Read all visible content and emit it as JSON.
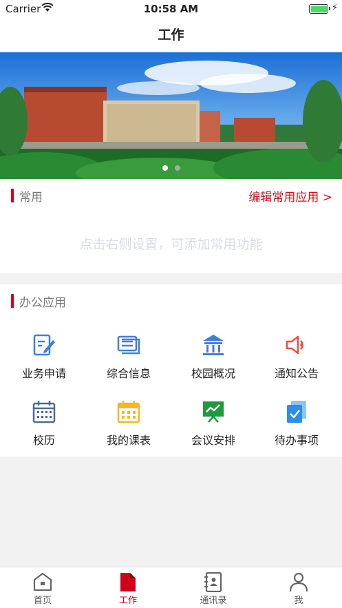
{
  "status": {
    "carrier": "Carrier",
    "time": "10:58 AM"
  },
  "nav": {
    "title": "工作"
  },
  "banner": {
    "slide_count": 2,
    "active_slide": 1
  },
  "common": {
    "title": "常用",
    "edit_link": "编辑常用应用 >",
    "empty_hint": "点击右侧设置，可添加常用功能"
  },
  "office": {
    "title": "办公应用",
    "items": [
      {
        "label": "业务申请",
        "icon": "edit-form-icon",
        "color": "#3f7fd8"
      },
      {
        "label": "综合信息",
        "icon": "info-list-icon",
        "color": "#3f7fd8"
      },
      {
        "label": "校园概况",
        "icon": "campus-building-icon",
        "color": "#3f7fd8"
      },
      {
        "label": "通知公告",
        "icon": "speaker-icon",
        "color": "#e8503c"
      },
      {
        "label": "校历",
        "icon": "calendar-icon",
        "color": "#4a6a9a"
      },
      {
        "label": "我的课表",
        "icon": "schedule-icon",
        "color": "#f5b820"
      },
      {
        "label": "会议安排",
        "icon": "meeting-board-icon",
        "color": "#1e9a3c"
      },
      {
        "label": "待办事项",
        "icon": "todo-icon",
        "color": "#2e8de8"
      }
    ]
  },
  "tabs": [
    {
      "label": "首页",
      "icon": "home-icon"
    },
    {
      "label": "工作",
      "icon": "work-doc-icon"
    },
    {
      "label": "通讯录",
      "icon": "contacts-icon"
    },
    {
      "label": "我",
      "icon": "profile-icon"
    }
  ],
  "colors": {
    "accent": "#d0021b",
    "link": "#c8141e",
    "battery": "#4cd964"
  }
}
